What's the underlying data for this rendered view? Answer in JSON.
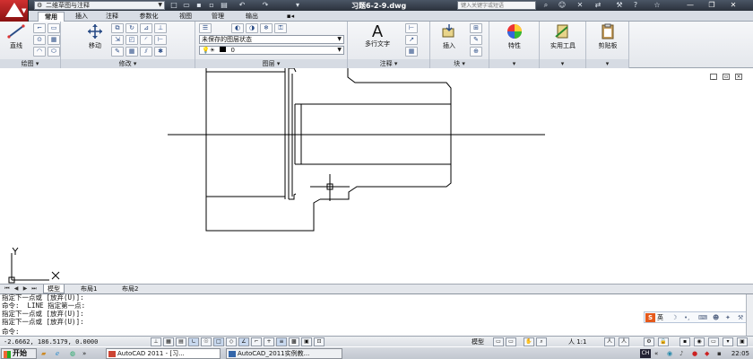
{
  "titlebar": {
    "workspace": "二维草图与注释",
    "document_title": "习题6-2-9.dwg",
    "search_placeholder": "键入关键字或短语"
  },
  "ribbon_tabs": [
    {
      "label": "常用",
      "active": true
    },
    {
      "label": "插入",
      "active": false
    },
    {
      "label": "注释",
      "active": false
    },
    {
      "label": "参数化",
      "active": false
    },
    {
      "label": "视图",
      "active": false
    },
    {
      "label": "管理",
      "active": false
    },
    {
      "label": "输出",
      "active": false
    }
  ],
  "ribbon": {
    "draw": {
      "title": "绘图",
      "line_label": "直线"
    },
    "modify": {
      "title": "修改",
      "move_label": "移动"
    },
    "layers": {
      "title": "图层",
      "layer_state": "未保存的图层状态",
      "current_layer": "0"
    },
    "annotation": {
      "title": "注释",
      "mtext_label": "多行文字"
    },
    "block": {
      "title": "块",
      "insert_label": "插入"
    },
    "properties": {
      "label": "特性"
    },
    "utilities": {
      "label": "实用工具"
    },
    "clipboard": {
      "label": "剪贴板"
    }
  },
  "layout_tabs": [
    {
      "label": "模型",
      "active": true
    },
    {
      "label": "布局1",
      "active": false
    },
    {
      "label": "布局2",
      "active": false
    }
  ],
  "command_lines": [
    "指定下一点或 [放弃(U)]:",
    "命令:  LINE 指定第一点:",
    "指定下一点或 [放弃(U)]:",
    "指定下一点或 [放弃(U)]:",
    "命令:"
  ],
  "ime": {
    "label": "英"
  },
  "statusbar": {
    "coords": "-2.6662, 186.5179, 0.0000",
    "model_label": "模型",
    "scale_label": "人 1:1"
  },
  "taskbar": {
    "start_label": "开始",
    "tasks": [
      {
        "label": "AutoCAD 2011 - [习...",
        "active": true
      },
      {
        "label": "AutoCAD_2011实例教...",
        "active": false
      }
    ],
    "lang": "CH",
    "clock": "22:05"
  },
  "colors": {
    "accent": "#c03030",
    "ribbon_bg": "#e4e7ec",
    "titlebar": "#2b323c"
  }
}
